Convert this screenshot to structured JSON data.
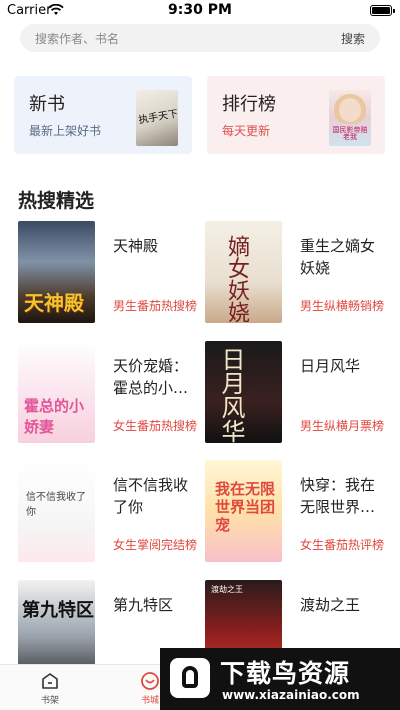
{
  "status_bar": {
    "carrier": "Carrier",
    "time": "9:30 PM"
  },
  "search": {
    "placeholder": "搜索作者、书名",
    "button": "搜索"
  },
  "cards": [
    {
      "title": "新书",
      "subtitle": "最新上架好书",
      "cover_text": "执手天下"
    },
    {
      "title": "排行榜",
      "subtitle": "每天更新",
      "cover_text": "国民影帝赔老我"
    }
  ],
  "section": {
    "title": "热搜精选"
  },
  "books": [
    {
      "name": "天神殿",
      "tag": "男生番茄热搜榜",
      "cover_text": "天神殿"
    },
    {
      "name": "重生之嫡女妖娆",
      "tag": "男生纵横畅销榜",
      "cover_text": "嫡女妖娆"
    },
    {
      "name": "天价宠婚：霍总的小…",
      "tag": "女生番茄热搜榜",
      "cover_text": "霍总的小娇妻"
    },
    {
      "name": "日月风华",
      "tag": "男生纵横月票榜",
      "cover_text": "日月风华"
    },
    {
      "name": "信不信我收了你",
      "tag": "女生掌阅完结榜",
      "cover_text": "信不信我收了你"
    },
    {
      "name": "快穿：我在无限世界…",
      "tag": "女生番茄热评榜",
      "cover_text": "我在无限世界当团宠"
    },
    {
      "name": "第九特区",
      "tag": "",
      "cover_text": "第九特区"
    },
    {
      "name": "渡劫之王",
      "tag": "",
      "cover_text": "渡劫之王"
    }
  ],
  "tabbar": {
    "shelf": "书架",
    "store": "书城"
  },
  "watermark": {
    "title": "下载鸟资源",
    "url": "www.xiazainiao.com"
  },
  "colors": {
    "accent": "#e0483f",
    "card_new_bg": "#eef2fb",
    "card_rank_bg": "#fbeeee"
  }
}
